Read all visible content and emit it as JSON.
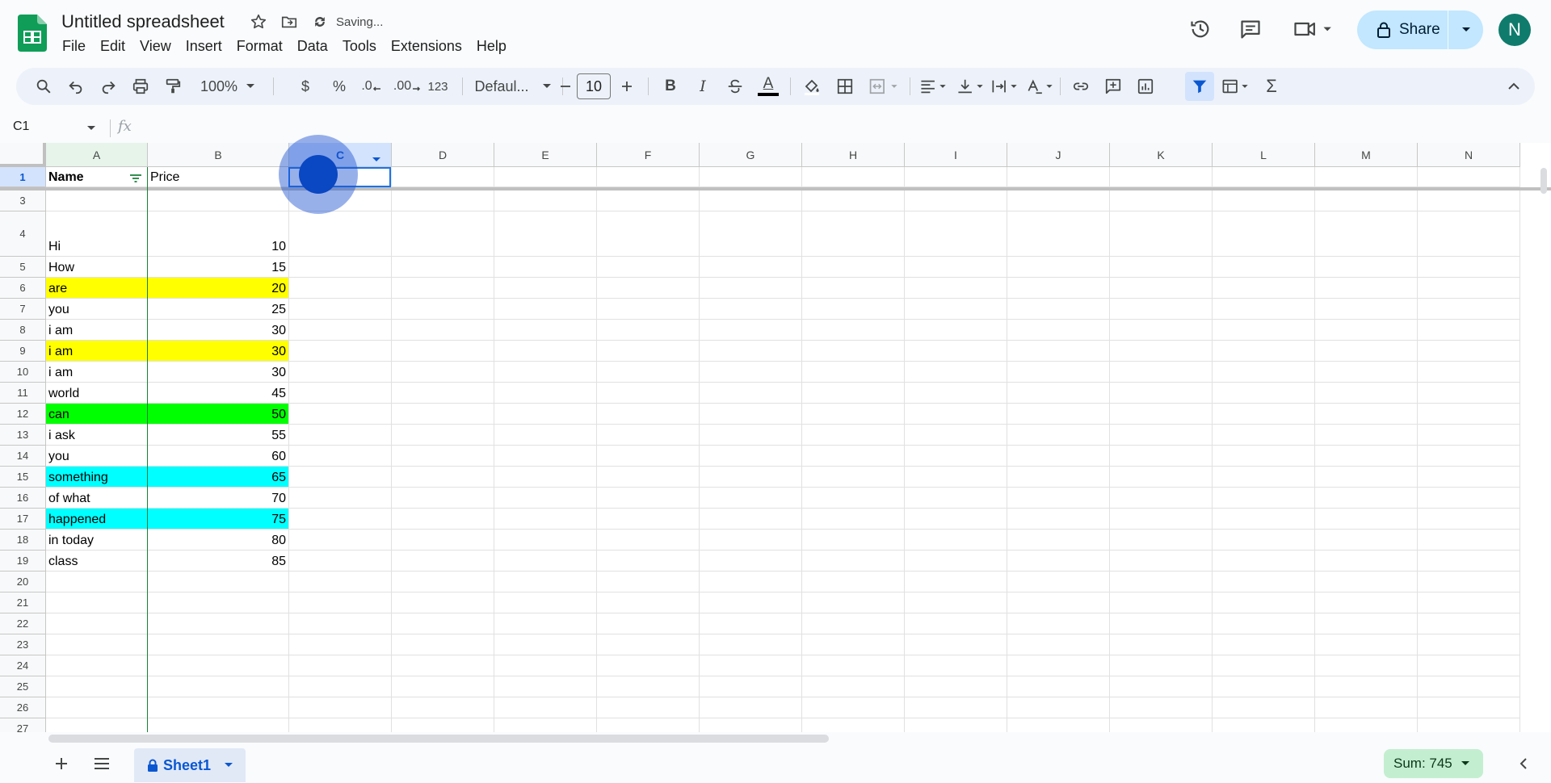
{
  "app": {
    "doc_title": "Untitled spreadsheet",
    "saving_status": "Saving...",
    "menu": [
      "File",
      "Edit",
      "View",
      "Insert",
      "Format",
      "Data",
      "Tools",
      "Extensions",
      "Help"
    ],
    "share_label": "Share",
    "avatar_initial": "N"
  },
  "toolbar": {
    "zoom": "100%",
    "currency": "$",
    "percent": "%",
    "dec_decrease": ".0",
    "dec_increase": ".00",
    "number_format": "123",
    "font": "Defaul...",
    "font_size": "10",
    "bold": "B",
    "italic": "I",
    "text_color": "A",
    "functions": "Σ"
  },
  "formula_bar": {
    "name_box": "C1",
    "fx": "fx"
  },
  "grid": {
    "columns": [
      "A",
      "B",
      "C",
      "D",
      "E",
      "F",
      "G",
      "H",
      "I",
      "J",
      "K",
      "L",
      "M",
      "N"
    ],
    "selected_column": "C",
    "selected_row": "1",
    "rows": [
      {
        "num": "1",
        "a": "Name",
        "b": "Price",
        "bg": ""
      },
      {
        "num": "3",
        "a": "",
        "b": "",
        "bg": ""
      },
      {
        "num": "4",
        "a": "Hi",
        "b": "10",
        "bg": ""
      },
      {
        "num": "5",
        "a": "How",
        "b": "15",
        "bg": ""
      },
      {
        "num": "6",
        "a": "are",
        "b": "20",
        "bg": "#ffff00"
      },
      {
        "num": "7",
        "a": "you",
        "b": "25",
        "bg": ""
      },
      {
        "num": "8",
        "a": "i am",
        "b": "30",
        "bg": ""
      },
      {
        "num": "9",
        "a": "i am",
        "b": "30",
        "bg": "#ffff00"
      },
      {
        "num": "10",
        "a": "i am",
        "b": "30",
        "bg": ""
      },
      {
        "num": "11",
        "a": "world",
        "b": "45",
        "bg": ""
      },
      {
        "num": "12",
        "a": "can",
        "b": "50",
        "bg": "#00ff00"
      },
      {
        "num": "13",
        "a": "i ask",
        "b": "55",
        "bg": ""
      },
      {
        "num": "14",
        "a": "you",
        "b": "60",
        "bg": ""
      },
      {
        "num": "15",
        "a": "something",
        "b": "65",
        "bg": "#00ffff"
      },
      {
        "num": "16",
        "a": "of what",
        "b": "70",
        "bg": ""
      },
      {
        "num": "17",
        "a": "happened",
        "b": "75",
        "bg": "#00ffff"
      },
      {
        "num": "18",
        "a": "in today",
        "b": "80",
        "bg": ""
      },
      {
        "num": "19",
        "a": "class",
        "b": "85",
        "bg": ""
      },
      {
        "num": "20",
        "a": "",
        "b": "",
        "bg": ""
      },
      {
        "num": "21",
        "a": "",
        "b": "",
        "bg": ""
      },
      {
        "num": "22",
        "a": "",
        "b": "",
        "bg": ""
      },
      {
        "num": "23",
        "a": "",
        "b": "",
        "bg": ""
      },
      {
        "num": "24",
        "a": "",
        "b": "",
        "bg": ""
      },
      {
        "num": "25",
        "a": "",
        "b": "",
        "bg": ""
      },
      {
        "num": "26",
        "a": "",
        "b": "",
        "bg": ""
      },
      {
        "num": "27",
        "a": "",
        "b": "",
        "bg": ""
      }
    ]
  },
  "bottom": {
    "sheet_name": "Sheet1",
    "sum_label": "Sum: 745"
  }
}
